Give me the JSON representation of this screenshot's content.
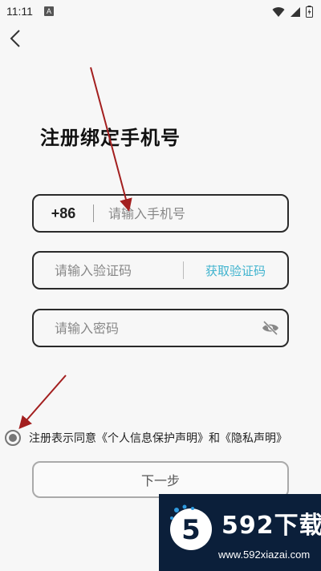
{
  "status_bar": {
    "time": "11:11",
    "notification_badge": "A",
    "icons": [
      "wifi-icon",
      "signal-icon",
      "battery-charging-icon"
    ]
  },
  "nav": {
    "back_icon": "chevron-left-icon"
  },
  "page": {
    "title": "注册绑定手机号"
  },
  "phone_field": {
    "country_code": "+86",
    "placeholder": "请输入手机号",
    "value": ""
  },
  "code_field": {
    "placeholder": "请输入验证码",
    "value": "",
    "get_code_label": "获取验证码"
  },
  "password_field": {
    "placeholder": "请输入密码",
    "value": "",
    "visibility_icon": "eye-off-icon"
  },
  "agreement": {
    "prefix": "注册表示同意",
    "privacy_protection_link": "《个人信息保护声明》",
    "conjunction": "和",
    "privacy_link": "《隐私声明》"
  },
  "next_button": {
    "label": "下一步"
  },
  "watermark": {
    "title": "592下载",
    "url": "www.592xiazai.com",
    "logo_char": "5"
  },
  "colors": {
    "accent": "#3fb3ce",
    "annotation_arrow": "#a31f1f",
    "background": "#f7f7f7",
    "watermark_bg": "#0b1f3a"
  }
}
